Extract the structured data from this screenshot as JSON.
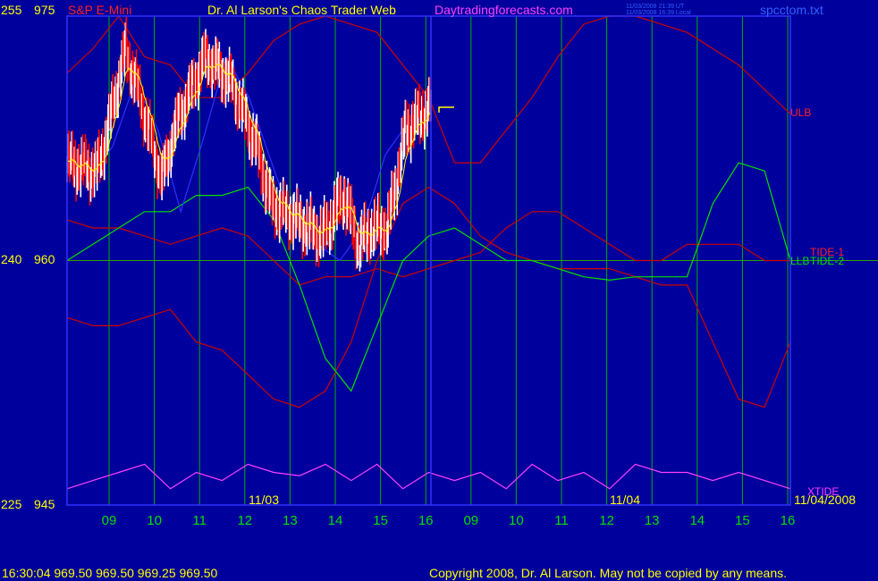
{
  "header": {
    "price_top_left": "255",
    "price_top_right": "975",
    "instrument": "S&P E-Mini",
    "chaos_title": "Dr. Al Larson's Chaos Trader Web",
    "site": "Daytradingforecasts.com",
    "ut_stamp": "11/03/2008 21:39 UT",
    "local_stamp": "11/03/2008 16:39 Local",
    "file": "spcctom.txt"
  },
  "axis": {
    "mid_left": "240",
    "mid_right": "960",
    "bot_left": "225",
    "bot_right": "945"
  },
  "line_labels": {
    "ulb": "ULB",
    "tide1": "TIDE-1",
    "llb": "LLB",
    "tide2": "TIDE-2",
    "xtide": "XTIDE"
  },
  "date_labels": {
    "d1": "11/03",
    "d2": "11/04",
    "d3": "11/04/2008"
  },
  "footer": {
    "quote": "16:30:04  969.50 969.50 969.25 969.50",
    "copyright": "Copyright 2008, Dr. Al Larson. May not be copied by any means."
  },
  "colors": {
    "background": "#00009c",
    "grid_vertical": "#00b000",
    "price_white": "#ffffff",
    "price_red": "#ff0000",
    "ema_yellow": "#ffff00",
    "band_red": "#d00000",
    "tide_green": "#00e000",
    "mid_blue": "#3030ff",
    "xtide_magenta": "#ff40ff",
    "title_magenta": "#ff40ff",
    "header_yellow": "#ffff00",
    "header_red": "#ff2020",
    "header_blue": "#3060ff"
  },
  "chart_data": {
    "type": "line",
    "y_right_range": [
      945,
      975
    ],
    "y_left_range": [
      225,
      255
    ],
    "x_ticks": [
      "09",
      "10",
      "11",
      "12",
      "13",
      "14",
      "15",
      "16",
      "09",
      "10",
      "11",
      "12",
      "13",
      "14",
      "15",
      "16"
    ],
    "series": [
      {
        "name": "ULB",
        "values": [
          971.5,
          973,
          975,
          972.5,
          972,
          970,
          970,
          971.5,
          973.5,
          974.5,
          975,
          974.5,
          974,
          972,
          970,
          966,
          966,
          968,
          970,
          972.5,
          974.5,
          975,
          975,
          974.5,
          974,
          973,
          972,
          970.5,
          969
        ]
      },
      {
        "name": "LLB",
        "values": [
          956.5,
          956,
          956,
          956.5,
          957,
          955,
          954.5,
          953,
          951.5,
          951,
          952,
          955,
          960,
          963.5,
          964.5,
          963.5,
          961.5,
          960.5,
          960,
          959.5,
          959.5,
          959.5,
          959,
          958.5,
          958.5,
          955,
          951.5,
          951,
          955
        ]
      },
      {
        "name": "TIDE-1",
        "values": [
          962.5,
          962,
          962,
          961.5,
          961,
          961.5,
          962,
          961.5,
          960,
          958.5,
          959,
          959,
          959.5,
          959,
          959.5,
          960,
          960.5,
          962,
          963,
          963,
          962,
          961,
          960,
          960,
          961,
          961,
          961,
          960,
          960
        ]
      },
      {
        "name": "TIDE-2",
        "values": [
          960,
          961,
          962,
          963,
          963,
          964,
          964,
          964.5,
          962.5,
          958.5,
          954,
          952,
          956,
          960,
          961.5,
          962,
          961,
          960,
          960,
          959.5,
          959,
          958.8,
          959,
          959,
          959,
          963.5,
          966,
          965.5,
          960
        ]
      },
      {
        "name": "XTIDE",
        "values": [
          946,
          946.5,
          947,
          947.5,
          946,
          947,
          946.5,
          947.5,
          947,
          946.8,
          947.5,
          946.5,
          947.5,
          946,
          947,
          946.5,
          947,
          946,
          947.5,
          946.5,
          947,
          946,
          947.5,
          947,
          947,
          946.5,
          947,
          946.5,
          946
        ]
      },
      {
        "name": "",
        "values": [
          966,
          965,
          967,
          971,
          968,
          963,
          967.5,
          972.5,
          970,
          966,
          962,
          961,
          960,
          962,
          966.5,
          968.5,
          969.5
        ]
      }
    ]
  }
}
